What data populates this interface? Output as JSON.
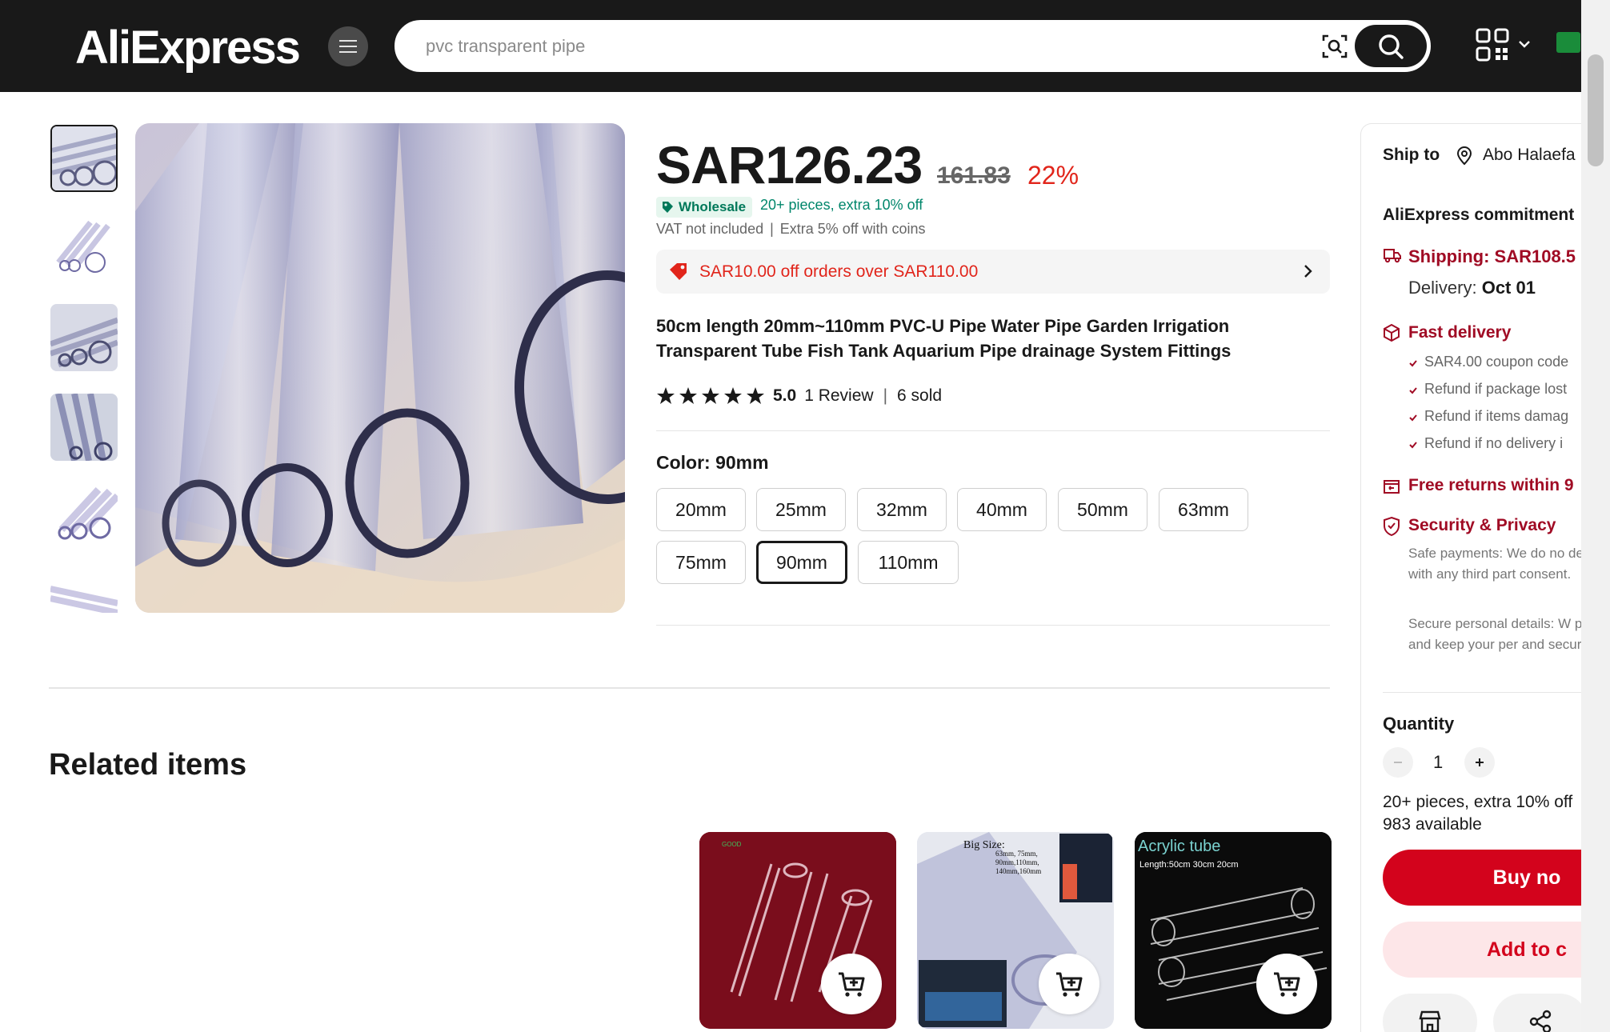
{
  "header": {
    "logo_text": "AliExpress",
    "search": {
      "placeholder": "pvc transparent pipe",
      "value": ""
    },
    "colors": {
      "bar": "#191919",
      "logo_accent": "#f7b500"
    }
  },
  "gallery": {
    "thumbnail_count": 6,
    "active_index": 0
  },
  "product": {
    "price": "SAR126.23",
    "original_price": "161.83",
    "discount": "22%",
    "wholesale_badge": "Wholesale",
    "wholesale_text": "20+ pieces, extra 10% off",
    "vat_line": "VAT not included",
    "coins_line": "Extra 5% off with coins",
    "coupon_text": "SAR10.00 off orders over SAR110.00",
    "title": "50cm length 20mm~110mm PVC-U Pipe Water Pipe Garden Irrigation Transparent Tube Fish Tank Aquarium Pipe drainage System Fittings",
    "rating": "5.0",
    "stars": 5,
    "reviews": "1 Review",
    "sold": "6 sold",
    "color_label": "Color: 90mm",
    "skus": [
      "20mm",
      "25mm",
      "32mm",
      "40mm",
      "50mm",
      "63mm",
      "75mm",
      "90mm",
      "110mm"
    ],
    "selected_sku": "90mm"
  },
  "related": {
    "title": "Related items",
    "cards": [
      {
        "name": "red-background-tubes",
        "bg": "#7a0d1c"
      },
      {
        "name": "big-size-tube",
        "caption": "Big Size:",
        "sub": "63mm, 75mm, 90mm,110mm, 140mm,160mm",
        "bg": "#e8eaf0"
      },
      {
        "name": "acrylic-tube",
        "caption": "Acrylic tube",
        "sub": "Length:50cm 30cm 20cm",
        "bg": "#0f0f0f"
      }
    ]
  },
  "sidebar": {
    "ship_to_label": "Ship to",
    "location": "Abo Halaefa",
    "commitment_title": "AliExpress commitment",
    "shipping": "Shipping: SAR108.5",
    "delivery_label": "Delivery:",
    "delivery_date": "Oct 01",
    "fast_delivery": "Fast delivery",
    "fast_items": [
      "SAR4.00 coupon code",
      "Refund if package lost",
      "Refund if items damag",
      "Refund if no delivery i"
    ],
    "free_returns": "Free returns within 9",
    "security_title": "Security & Privacy",
    "security_p1": "Safe payments: We do no details with any third part consent.",
    "security_p2": "Secure personal details: W privacy and keep your per and secure.",
    "quantity_label": "Quantity",
    "quantity": "1",
    "qty_note_1": "20+ pieces, extra 10% off",
    "qty_note_2": "983 available",
    "buy_now": "Buy no",
    "add_to_cart": "Add to c",
    "accent_red": "#d3031c",
    "accent_dark_red": "#a00b24"
  }
}
